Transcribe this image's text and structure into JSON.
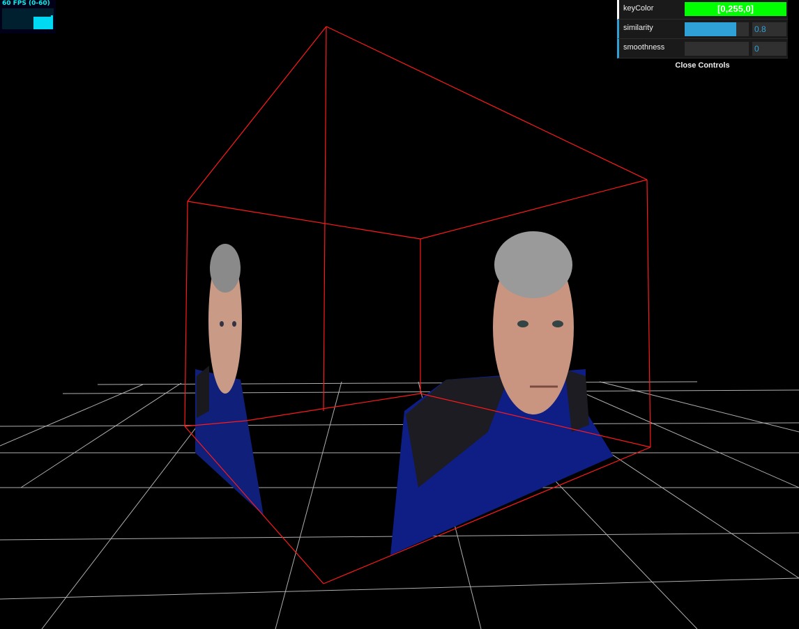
{
  "stats": {
    "fps_label": "60 FPS (0-60)"
  },
  "gui": {
    "controls": [
      {
        "name": "keyColor",
        "type": "color",
        "value": "[0,255,0]",
        "color": "#00ff00"
      },
      {
        "name": "similarity",
        "type": "number",
        "value": "0.8",
        "fraction": 0.8
      },
      {
        "name": "smoothness",
        "type": "number",
        "value": "0",
        "fraction": 0
      }
    ],
    "close_label": "Close Controls"
  },
  "scene": {
    "line_color": "#ff0000",
    "grid_color": "#ffffff",
    "background": "#000000"
  }
}
